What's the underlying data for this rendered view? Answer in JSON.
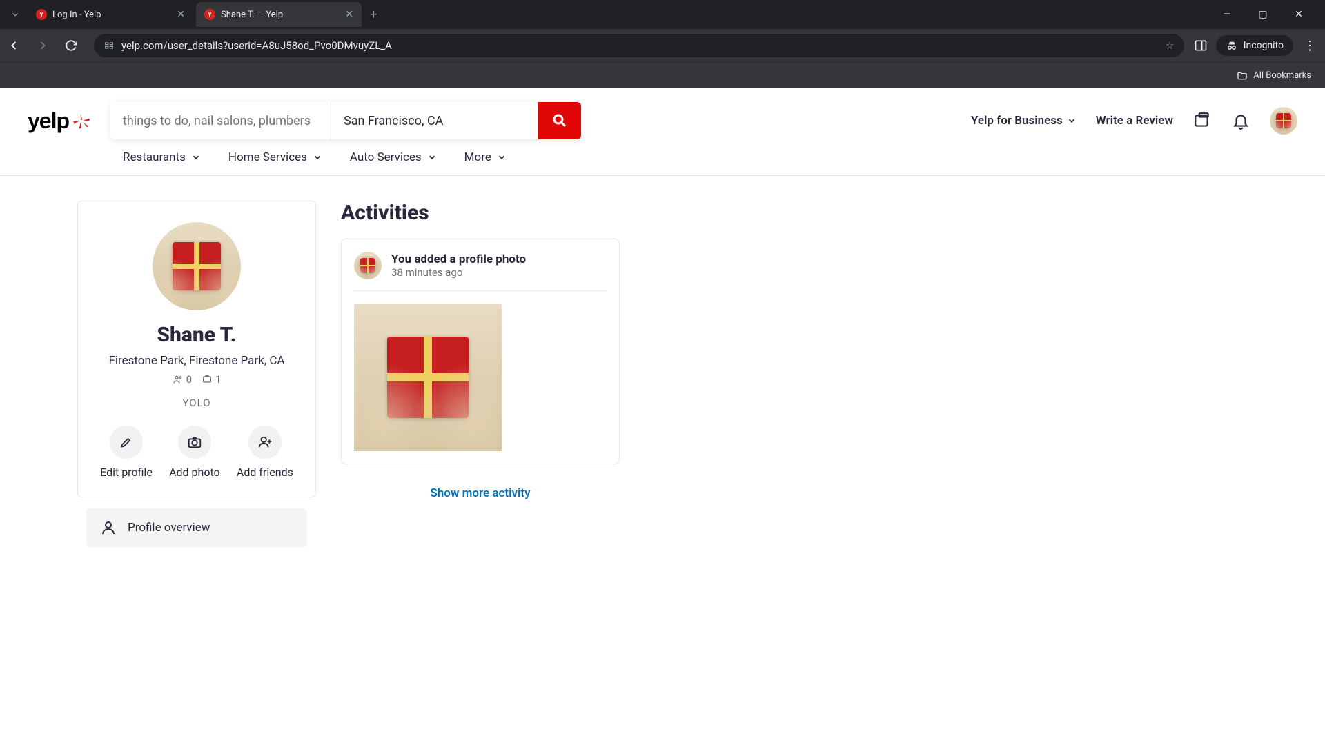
{
  "browser": {
    "tabs": [
      {
        "title": "Log In - Yelp",
        "active": false
      },
      {
        "title": "Shane T. — Yelp",
        "active": true
      }
    ],
    "url": "yelp.com/user_details?userid=A8uJ58od_Pvo0DMvuyZL_A",
    "incognito_label": "Incognito",
    "bookmarks_label": "All Bookmarks"
  },
  "header": {
    "search_placeholder": "things to do, nail salons, plumbers",
    "location_value": "San Francisco, CA",
    "business_link": "Yelp for Business",
    "write_review": "Write a Review"
  },
  "categories": [
    "Restaurants",
    "Home Services",
    "Auto Services",
    "More"
  ],
  "profile": {
    "name": "Shane T.",
    "location": "Firestone Park, Firestone Park, CA",
    "friends_count": "0",
    "photos_count": "1",
    "tagline": "YOLO",
    "actions": {
      "edit": "Edit profile",
      "photo": "Add photo",
      "friends": "Add friends"
    }
  },
  "sidebar": {
    "overview": "Profile overview"
  },
  "activities": {
    "heading": "Activities",
    "items": [
      {
        "title": "You added a profile photo",
        "time": "38 minutes ago"
      }
    ],
    "show_more": "Show more activity"
  }
}
